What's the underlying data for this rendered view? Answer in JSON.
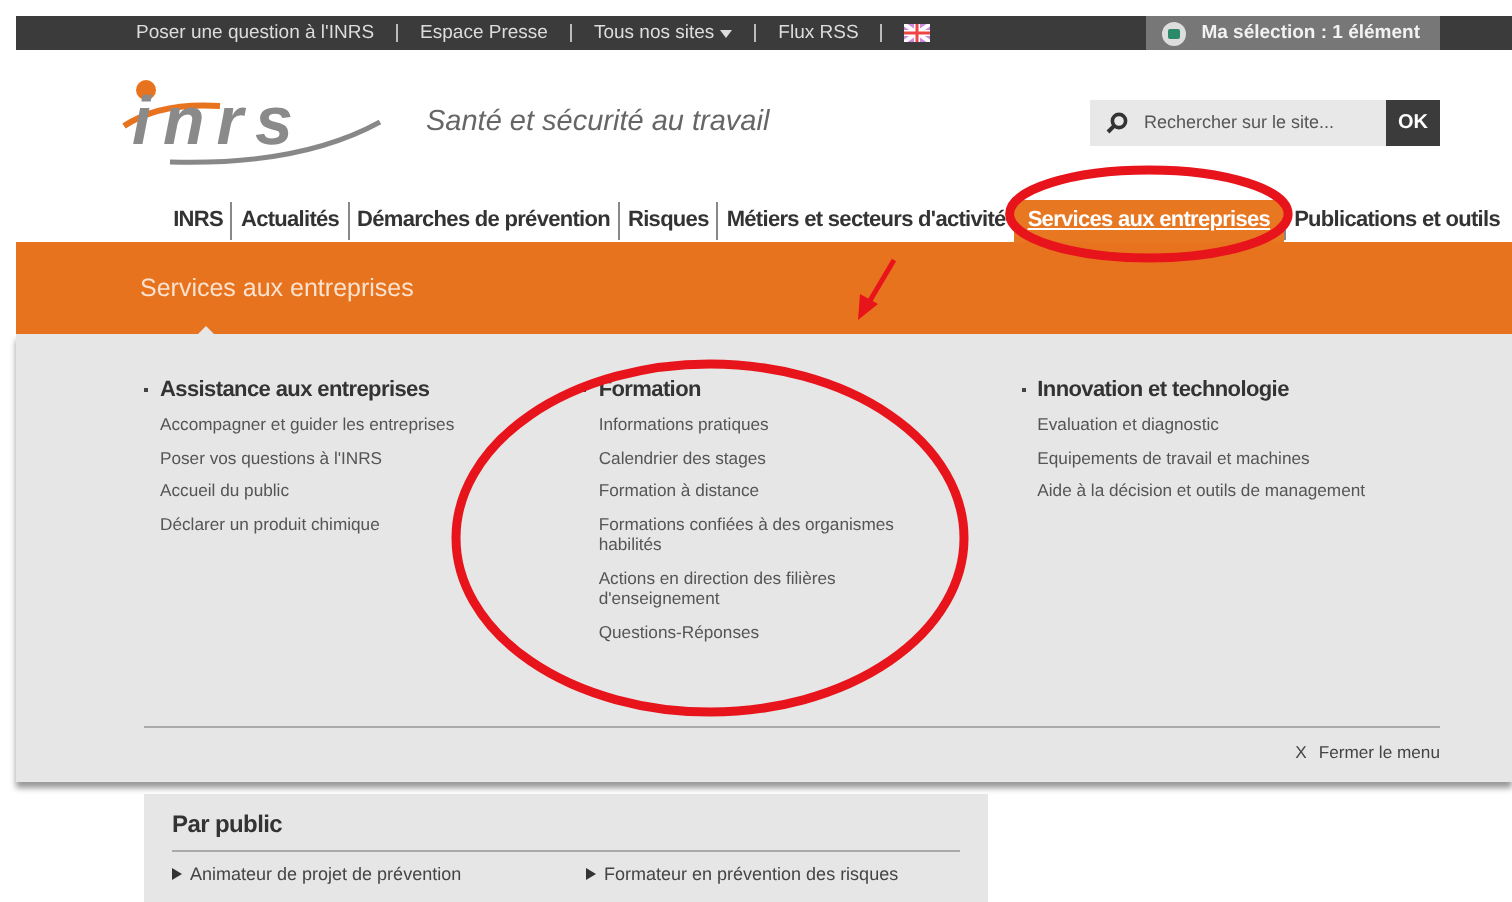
{
  "top_bar": {
    "links": [
      {
        "label": "Poser une question à l'INRS",
        "kind": "link"
      },
      {
        "label": "Espace Presse",
        "kind": "link"
      },
      {
        "label": "Tous nos sites",
        "kind": "dropdown"
      },
      {
        "label": "Flux RSS",
        "kind": "link"
      },
      {
        "kind": "flag"
      }
    ],
    "selection": "Ma sélection : 1 élément"
  },
  "header": {
    "logo": "inrs",
    "tagline": "Santé et sécurité au travail",
    "search": {
      "placeholder": "Rechercher sur le site...",
      "button": "OK"
    }
  },
  "nav": [
    {
      "label": "INRS",
      "selected": false
    },
    {
      "label": "Actualités",
      "selected": false
    },
    {
      "label": "Démarches de prévention",
      "selected": false
    },
    {
      "label": "Risques",
      "selected": false
    },
    {
      "label": "Métiers et secteurs d'activité",
      "selected": false
    },
    {
      "label": "Services aux entreprises",
      "selected": true
    },
    {
      "label": "Publications et outils",
      "selected": false
    }
  ],
  "mega_menu": {
    "title": "Services aux entreprises",
    "columns": [
      {
        "heading": "Assistance aux entreprises",
        "items": [
          "Accompagner et guider les entreprises",
          "Poser vos questions à l'INRS",
          "Accueil du public",
          "Déclarer un produit chimique"
        ]
      },
      {
        "heading": "Formation",
        "items": [
          "Informations pratiques",
          "Calendrier des stages",
          "Formation à distance",
          "Formations confiées à des organismes habilités",
          "Actions en direction des filières d'enseignement",
          "Questions-Réponses"
        ]
      },
      {
        "heading": "Innovation et technologie",
        "items": [
          "Evaluation et diagnostic",
          "Equipements de travail et machines",
          "Aide à la décision et outils de management"
        ]
      }
    ],
    "close_icon": "X",
    "close": "Fermer le menu"
  },
  "par_public": {
    "title": "Par public",
    "items": [
      "Animateur de projet de prévention",
      "Formateur en prévention des risques"
    ]
  }
}
